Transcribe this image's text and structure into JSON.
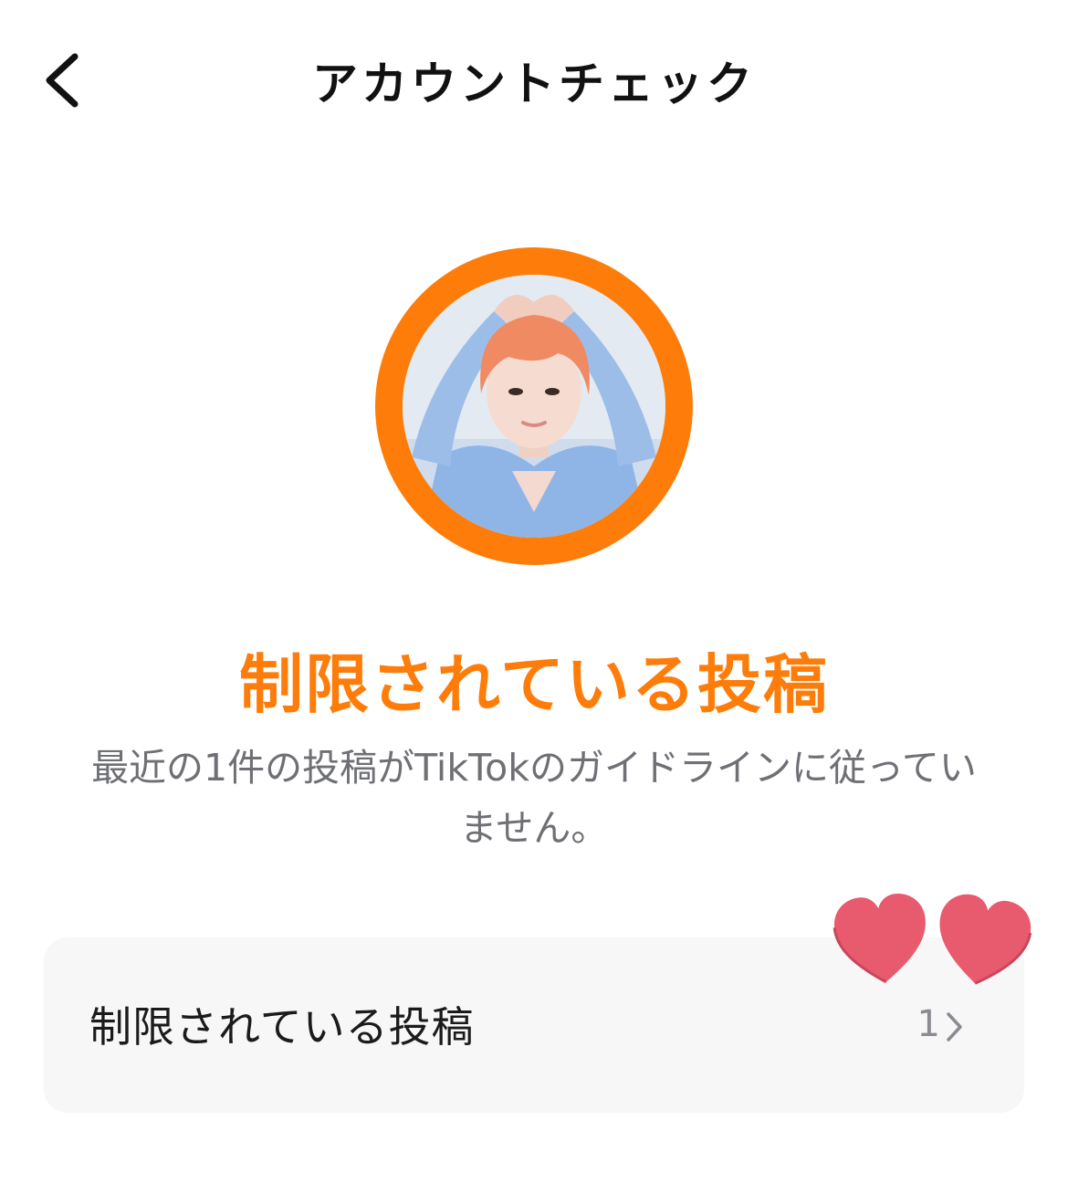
{
  "header": {
    "title": "アカウントチェック",
    "back_icon": "chevron-left-icon"
  },
  "profile": {
    "ring_color": "#fe7c09"
  },
  "status": {
    "title": "制限されている投稿",
    "description": "最近の1件の投稿がTikTokのガイドラインに従っていません。",
    "title_color": "#fe7c09"
  },
  "restricted_row": {
    "label": "制限されている投稿",
    "count": "1",
    "chevron_icon": "chevron-right-icon"
  },
  "stickers": {
    "icon": "heart-icon",
    "color": "#e85a6e"
  }
}
